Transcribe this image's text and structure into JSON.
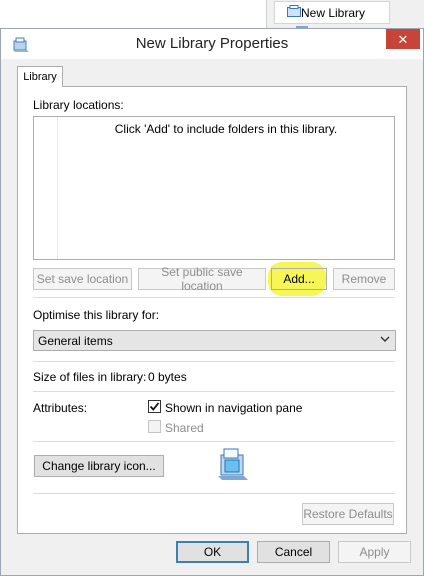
{
  "context_menu": {
    "item_label": "New Library"
  },
  "window": {
    "title": "New Library Properties",
    "close_glyph": "✕"
  },
  "tabs": [
    {
      "label": "Library",
      "selected": true
    }
  ],
  "library_locations": {
    "label": "Library locations:",
    "empty_message": "Click 'Add' to include folders in this library.",
    "buttons": {
      "set_save": "Set save location",
      "set_public_save": "Set public save location",
      "add": "Add...",
      "remove": "Remove"
    }
  },
  "optimise": {
    "label": "Optimise this library for:",
    "selected": "General items"
  },
  "size": {
    "label": "Size of files in library:",
    "value": "0 bytes"
  },
  "attributes": {
    "label": "Attributes:",
    "shown_in_nav": {
      "label": "Shown in navigation pane",
      "checked": true
    },
    "shared": {
      "label": "Shared",
      "checked": false,
      "disabled": true
    }
  },
  "change_icon_label": "Change library icon...",
  "restore_defaults_label": "Restore Defaults",
  "footer": {
    "ok": "OK",
    "cancel": "Cancel",
    "apply": "Apply"
  },
  "colors": {
    "close_red": "#c7443a",
    "highlight_yellow": "#f5f53a",
    "accent_blue": "#3c7fb1"
  },
  "icons": [
    "library-icon",
    "close-icon",
    "chevron-down-icon",
    "checkmark-icon"
  ]
}
